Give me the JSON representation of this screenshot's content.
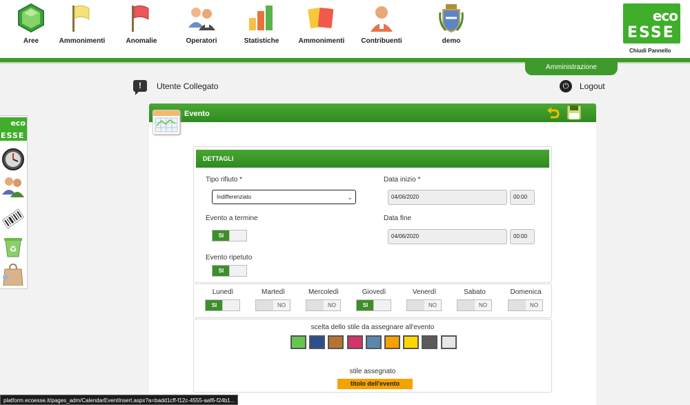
{
  "nav": {
    "items": [
      {
        "label": "Aree",
        "icon": "hexagon-icon"
      },
      {
        "label": "Ammonimenti",
        "icon": "yellow-flag-icon"
      },
      {
        "label": "Anomalie",
        "icon": "red-flag-icon"
      },
      {
        "label": "Operatori",
        "icon": "people-icon"
      },
      {
        "label": "Statistiche",
        "icon": "bar-chart-icon"
      },
      {
        "label": "Ammonimenti",
        "icon": "cards-icon"
      },
      {
        "label": "Contribuenti",
        "icon": "person-icon"
      },
      {
        "label": "demo",
        "icon": "coat-of-arms-icon"
      }
    ],
    "logo": {
      "top": "eco",
      "bottom": "ESSE"
    },
    "close_panel": "Chiudi Pannello",
    "admin_tab": "Amministrazione"
  },
  "userbar": {
    "icon_glyph": "!",
    "user_label": "Utente Collegato",
    "logout_label": "Logout"
  },
  "sidebar": {
    "logo": {
      "top": "eco",
      "bottom": "ESSE"
    },
    "items": [
      "clock-icon",
      "users-icon",
      "barcode-icon",
      "recycle-bin-icon",
      "bag-icon"
    ]
  },
  "panel": {
    "title": "Evento",
    "details": {
      "header": "DETTAGLI",
      "tipo_rifiuto_label": "Tipo rifiuto *",
      "tipo_rifiuto_value": "Indifferenziato",
      "data_inizio_label": "Data inizio *",
      "data_inizio_date": "04/06/2020",
      "data_inizio_time": "00:00",
      "evento_termine_label": "Evento a termine",
      "evento_termine_value": "SI",
      "data_fine_label": "Data fine",
      "data_fine_date": "04/06/2020",
      "data_fine_time": "00:00",
      "evento_ripetuto_label": "Evento ripetuto",
      "evento_ripetuto_value": "SI"
    },
    "days": [
      {
        "label": "Lunedì",
        "value": "SI"
      },
      {
        "label": "Martedì",
        "value": "NO"
      },
      {
        "label": "Mercoledì",
        "value": "NO"
      },
      {
        "label": "Giovedì",
        "value": "SI"
      },
      {
        "label": "Venerdì",
        "value": "NO"
      },
      {
        "label": "Sabato",
        "value": "NO"
      },
      {
        "label": "Domenica",
        "value": "NO"
      }
    ],
    "style": {
      "label": "scelta dello stile da assegnare all'evento",
      "swatches": [
        "#66c552",
        "#2a4f8f",
        "#b87333",
        "#d6336c",
        "#5b88aa",
        "#f5a100",
        "#ffd700",
        "#5a5a5a",
        "#e6e6e6"
      ],
      "assigned_label": "stile assegnato",
      "event_title": "titolo dell'evento"
    }
  },
  "status_url": "platform.ecoesse.it/pages_adm/CalendarEventInsert.aspx?a=badd1cff-f12c-4555-aaf6-f24b1..."
}
